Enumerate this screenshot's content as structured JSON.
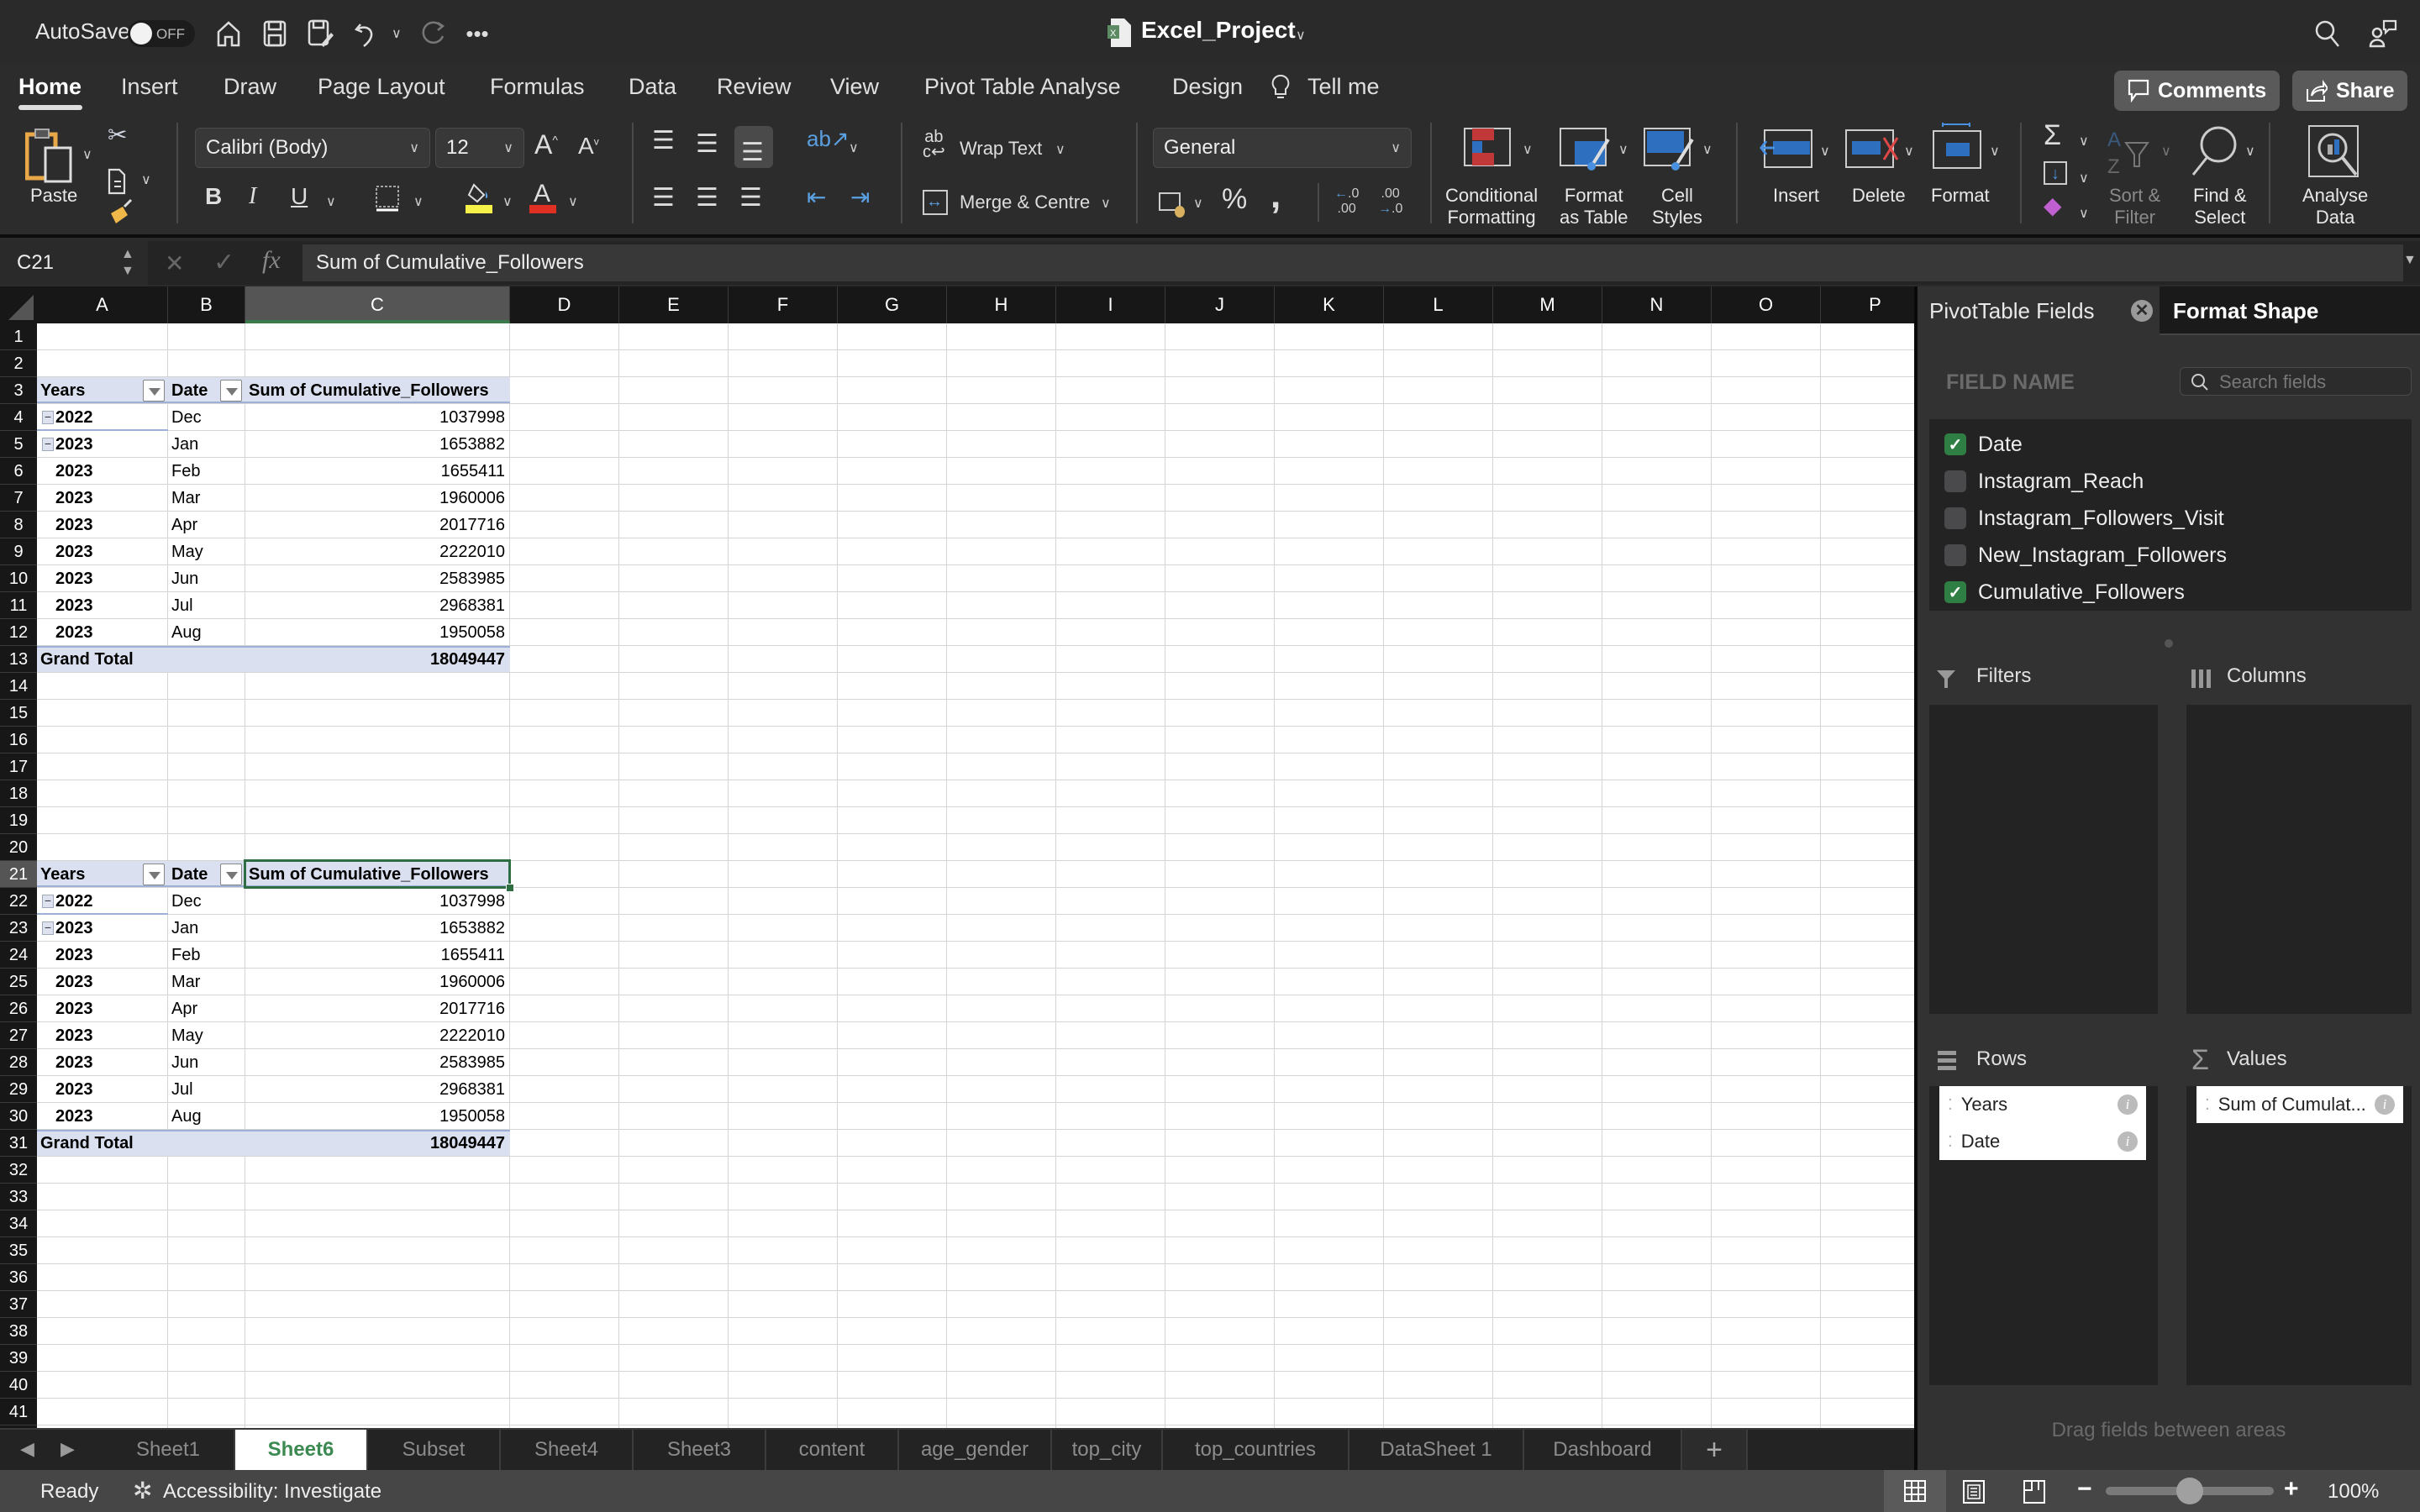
{
  "titlebar": {
    "autosave_label": "AutoSave",
    "autosave_state": "OFF",
    "doc_title": "Excel_Project",
    "icons": [
      "home-icon",
      "save-icon",
      "save-as-icon",
      "undo-icon",
      "redo-icon",
      "more-icon",
      "search-icon",
      "share-people-icon"
    ]
  },
  "ribbon_tabs": [
    "Home",
    "Insert",
    "Draw",
    "Page Layout",
    "Formulas",
    "Data",
    "Review",
    "View",
    "Pivot Table Analyse",
    "Design"
  ],
  "active_tab": "Home",
  "tell_me": "Tell me",
  "comments_label": "Comments",
  "share_label": "Share",
  "ribbon": {
    "paste_label": "Paste",
    "font_name": "Calibri (Body)",
    "font_size": "12",
    "bold": "B",
    "italic": "I",
    "underline": "U",
    "fill_color": "#f7f24a",
    "font_color": "#e03024",
    "wrap_text": "Wrap Text",
    "merge_centre": "Merge & Centre",
    "number_format": "General",
    "percent": "%",
    "comma": ",",
    "conditional_formatting": "Conditional\nFormatting",
    "format_as_table": "Format\nas Table",
    "cell_styles": "Cell\nStyles",
    "insert": "Insert",
    "delete": "Delete",
    "format": "Format",
    "sort_filter": "Sort &\nFilter",
    "find_select": "Find &\nSelect",
    "analyse_data": "Analyse\nData"
  },
  "formula_bar": {
    "name_box": "C21",
    "fx": "fx",
    "formula": "Sum of Cumulative_Followers"
  },
  "columns": [
    "A",
    "B",
    "C",
    "D",
    "E",
    "F",
    "G",
    "H",
    "I",
    "J",
    "K",
    "L",
    "M",
    "N",
    "O",
    "P"
  ],
  "selected_column": "C",
  "selected_row": 21,
  "row_count": 41,
  "pivot_tables": [
    {
      "header_row": 3,
      "headers": [
        "Years",
        "Date",
        "Sum of Cumulative_Followers"
      ],
      "rows": [
        {
          "year": "2022",
          "date": "Dec",
          "value": "1037998",
          "collapse": true
        },
        {
          "year": "2023",
          "date": "Jan",
          "value": "1653882",
          "collapse": true
        },
        {
          "year": "2023",
          "date": "Feb",
          "value": "1655411",
          "collapse": false
        },
        {
          "year": "2023",
          "date": "Mar",
          "value": "1960006",
          "collapse": false
        },
        {
          "year": "2023",
          "date": "Apr",
          "value": "2017716",
          "collapse": false
        },
        {
          "year": "2023",
          "date": "May",
          "value": "2222010",
          "collapse": false
        },
        {
          "year": "2023",
          "date": "Jun",
          "value": "2583985",
          "collapse": false
        },
        {
          "year": "2023",
          "date": "Jul",
          "value": "2968381",
          "collapse": false
        },
        {
          "year": "2023",
          "date": "Aug",
          "value": "1950058",
          "collapse": false
        }
      ],
      "grand_total_label": "Grand Total",
      "grand_total": "18049447"
    },
    {
      "header_row": 21,
      "headers": [
        "Years",
        "Date",
        "Sum of Cumulative_Followers"
      ],
      "rows": [
        {
          "year": "2022",
          "date": "Dec",
          "value": "1037998",
          "collapse": true
        },
        {
          "year": "2023",
          "date": "Jan",
          "value": "1653882",
          "collapse": true
        },
        {
          "year": "2023",
          "date": "Feb",
          "value": "1655411",
          "collapse": false
        },
        {
          "year": "2023",
          "date": "Mar",
          "value": "1960006",
          "collapse": false
        },
        {
          "year": "2023",
          "date": "Apr",
          "value": "2017716",
          "collapse": false
        },
        {
          "year": "2023",
          "date": "May",
          "value": "2222010",
          "collapse": false
        },
        {
          "year": "2023",
          "date": "Jun",
          "value": "2583985",
          "collapse": false
        },
        {
          "year": "2023",
          "date": "Jul",
          "value": "2968381",
          "collapse": false
        },
        {
          "year": "2023",
          "date": "Aug",
          "value": "1950058",
          "collapse": false
        }
      ],
      "grand_total_label": "Grand Total",
      "grand_total": "18049447"
    }
  ],
  "sheet_tabs": [
    "Sheet1",
    "Sheet6",
    "Subset",
    "Sheet4",
    "Sheet3",
    "content",
    "age_gender",
    "top_city",
    "top_countries",
    "DataSheet 1",
    "Dashboard"
  ],
  "active_sheet": "Sheet6",
  "status": {
    "ready": "Ready",
    "accessibility": "Accessibility: Investigate",
    "zoom": "100%",
    "zoom_fraction": 0.5
  },
  "pivot_pane": {
    "tab_active": "PivotTable Fields",
    "tab_other": "Format Shape",
    "field_name_label": "FIELD NAME",
    "search_placeholder": "Search fields",
    "fields": [
      {
        "name": "Date",
        "checked": true
      },
      {
        "name": "Instagram_Reach",
        "checked": false
      },
      {
        "name": "Instagram_Followers_Visit",
        "checked": false
      },
      {
        "name": "New_Instagram_Followers",
        "checked": false
      },
      {
        "name": "Cumulative_Followers",
        "checked": true
      }
    ],
    "filters_label": "Filters",
    "columns_label": "Columns",
    "rows_label": "Rows",
    "values_label": "Values",
    "rows_items": [
      "Years",
      "Date"
    ],
    "values_items": [
      "Sum of Cumulat..."
    ],
    "footer_hint": "Drag fields between areas"
  }
}
